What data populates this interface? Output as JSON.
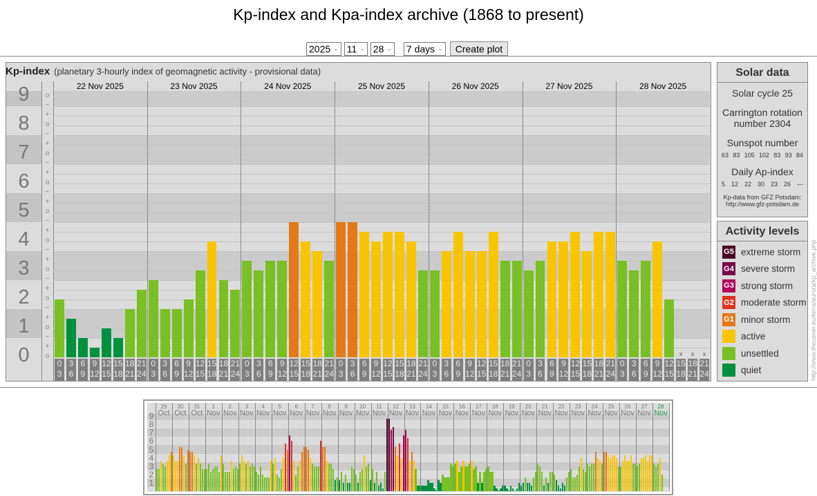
{
  "title": "Kp-index and Kpa-index archive (1868 to present)",
  "form": {
    "year": "2025",
    "month": "11",
    "day": "28",
    "range": "7 days",
    "button": "Create plot"
  },
  "kp_panel": {
    "name": "Kp-index",
    "subtitle": "(planetary 3-hourly index of geomagnetic activity - provisional data)"
  },
  "solar": {
    "title": "Solar data",
    "cycle": "Solar cycle 25",
    "carrington_1": "Carrington rotation",
    "carrington_2": "number 2304",
    "sunspot_label": "Sunspot number",
    "sunspots": [
      "63",
      "83",
      "105",
      "102",
      "83",
      "93",
      "84"
    ],
    "ap_label": "Daily Ap-index",
    "ap": [
      "5",
      "12",
      "22",
      "30",
      "23",
      "26",
      "---"
    ],
    "credit_1": "Kp-data from GFZ Potsdam:",
    "credit_2": "http://www.gfz-potsdam.de"
  },
  "activity": {
    "title": "Activity levels",
    "levels": [
      {
        "badge": "G5",
        "label": "extreme storm",
        "color": "#4a0726"
      },
      {
        "badge": "G4",
        "label": "severe storm",
        "color": "#7a0848"
      },
      {
        "badge": "G3",
        "label": "strong storm",
        "color": "#b0005a"
      },
      {
        "badge": "G2",
        "label": "moderate storm",
        "color": "#dc3420"
      },
      {
        "badge": "G1",
        "label": "minor storm",
        "color": "#e57917"
      },
      {
        "badge": "",
        "label": "active",
        "color": "#f8c500"
      },
      {
        "badge": "",
        "label": "unsettled",
        "color": "#78c023"
      },
      {
        "badge": "",
        "label": "quiet",
        "color": "#00913f"
      }
    ]
  },
  "side_url": "http://www.theusner.eu/terra/aurora/kp_archive.php",
  "chart_data": [
    {
      "type": "bar",
      "title": "Kp-index",
      "ylim": [
        0,
        9
      ],
      "y_labels": [
        "0",
        "1",
        "2",
        "3",
        "4",
        "5",
        "6",
        "7",
        "8",
        "9"
      ],
      "tick_marks": {
        "minus": "−",
        "zero": "o",
        "plus": "+"
      },
      "days": [
        "22 Nov 2025",
        "23 Nov 2025",
        "24 Nov 2025",
        "25 Nov 2025",
        "26 Nov 2025",
        "27 Nov 2025",
        "28 Nov 2025"
      ],
      "intervals": [
        [
          "0",
          "3"
        ],
        [
          "3",
          "6"
        ],
        [
          "6",
          "9"
        ],
        [
          "9",
          "12"
        ],
        [
          "12",
          "15"
        ],
        [
          "15",
          "18"
        ],
        [
          "18",
          "21"
        ],
        [
          "21",
          "24"
        ]
      ],
      "missing_mark": "x",
      "values": [
        [
          2,
          1.33,
          0.67,
          0.33,
          1,
          0.67,
          1.67,
          2.33
        ],
        [
          2.67,
          1.67,
          1.67,
          2,
          3,
          4,
          2.67,
          2.33
        ],
        [
          3.33,
          3,
          3.33,
          3.33,
          4.67,
          4,
          3.67,
          3.33
        ],
        [
          4.67,
          4.67,
          4.33,
          4,
          4.33,
          4.33,
          4,
          3
        ],
        [
          3,
          3.67,
          4.33,
          3.67,
          3.67,
          4.33,
          3.33,
          3.33
        ],
        [
          3,
          3.33,
          4,
          4,
          4.33,
          3.67,
          4.33,
          4.33
        ],
        [
          3.33,
          3,
          3.33,
          4,
          2,
          null,
          null,
          null
        ]
      ]
    },
    {
      "type": "bar",
      "title": "Kp-index overview",
      "ylim": [
        0,
        9
      ],
      "y_labels": [
        "1",
        "2",
        "3",
        "4",
        "5",
        "6",
        "7",
        "8",
        "9"
      ],
      "days": [
        [
          "29",
          "Oct"
        ],
        [
          "30",
          "Oct"
        ],
        [
          "31",
          "Oct"
        ],
        [
          "1",
          "Nov"
        ],
        [
          "2",
          "Nov"
        ],
        [
          "3",
          "Nov"
        ],
        [
          "4",
          "Nov"
        ],
        [
          "5",
          "Nov"
        ],
        [
          "6",
          "Nov"
        ],
        [
          "7",
          "Nov"
        ],
        [
          "8",
          "Nov"
        ],
        [
          "9",
          "Nov"
        ],
        [
          "10",
          "Nov"
        ],
        [
          "11",
          "Nov"
        ],
        [
          "12",
          "Nov"
        ],
        [
          "13",
          "Nov"
        ],
        [
          "14",
          "Nov"
        ],
        [
          "15",
          "Nov"
        ],
        [
          "16",
          "Nov"
        ],
        [
          "17",
          "Nov"
        ],
        [
          "18",
          "Nov"
        ],
        [
          "19",
          "Nov"
        ],
        [
          "20",
          "Nov"
        ],
        [
          "21",
          "Nov"
        ],
        [
          "22",
          "Nov"
        ],
        [
          "23",
          "Nov"
        ],
        [
          "24",
          "Nov"
        ],
        [
          "25",
          "Nov"
        ],
        [
          "26",
          "Nov"
        ],
        [
          "27",
          "Nov"
        ],
        [
          "28",
          "Nov"
        ]
      ],
      "current_day_color": "#1a9a4a",
      "values": [
        [
          2.67,
          2.67,
          3.67,
          3.33,
          3,
          3.67,
          4.33,
          4.67
        ],
        [
          4.33,
          3.67,
          3.67,
          5.33,
          5.33,
          4.33,
          3.33,
          5
        ],
        [
          4.67,
          4.67,
          4.33,
          3.33,
          4,
          3.33,
          2.67,
          2.67
        ],
        [
          2.67,
          3.33,
          2.33,
          2.67,
          3,
          3,
          2.33,
          4.33
        ],
        [
          3.33,
          2.33,
          2.33,
          2.33,
          3.67,
          2.67,
          3,
          2.67
        ],
        [
          3.33,
          4.33,
          3.67,
          3.33,
          3.67,
          3,
          3.33,
          3
        ],
        [
          2.33,
          2,
          3,
          2,
          1.67,
          1.67,
          1.67,
          3.67
        ],
        [
          3.33,
          4,
          2,
          1.67,
          2.67,
          4,
          5.67,
          5
        ],
        [
          6.67,
          6,
          3.67,
          2,
          3,
          3.67,
          4.67,
          5.33
        ],
        [
          5.33,
          5,
          4,
          3.33,
          3,
          3,
          3,
          6
        ],
        [
          5.33,
          5.33,
          3.67,
          3.33,
          3.33,
          2.67,
          1.33,
          1.67
        ],
        [
          1.33,
          2.33,
          1,
          2,
          1,
          1,
          3,
          2.67
        ],
        [
          2,
          1,
          2.33,
          2.67,
          4.33,
          3,
          3.33,
          1.33
        ],
        [
          2.67,
          1,
          2.33,
          0.67,
          1,
          0.33,
          2.33,
          8.67
        ],
        [
          8.67,
          7.33,
          7.67,
          5.33,
          4.33,
          5.67,
          4,
          6.67
        ],
        [
          7.33,
          6.33,
          3.67,
          4.67,
          3.67,
          2.67,
          0.67,
          0.67
        ],
        [
          0.67,
          0.67,
          0.67,
          1.33,
          1,
          1,
          0.33,
          0
        ],
        [
          1.33,
          1,
          2,
          1.67,
          1.67,
          1.67,
          3.33,
          3
        ],
        [
          3.33,
          3.67,
          2.33,
          3,
          3.67,
          3,
          3,
          3.33
        ],
        [
          3.67,
          2.67,
          3,
          1,
          2.33,
          1,
          2.33,
          2.67
        ],
        [
          3,
          2.33,
          2.33,
          0.67,
          0.33,
          0,
          0.33,
          0.67
        ],
        [
          0.67,
          0.33,
          0,
          0.67,
          0.33,
          0,
          0.33,
          1
        ],
        [
          0.67,
          1,
          1.67,
          1,
          1,
          0.67,
          1.67,
          2.33
        ],
        [
          3.33,
          3,
          2.33,
          0.67,
          1.67,
          1,
          2.33,
          2.33
        ],
        [
          2,
          1.33,
          0.67,
          0.33,
          1,
          0.67,
          1.67,
          2.33
        ],
        [
          2.67,
          1.67,
          1.67,
          2,
          3,
          4,
          2.67,
          2.33
        ],
        [
          3.33,
          3,
          3.33,
          3.33,
          4.67,
          4,
          3.67,
          3.33
        ],
        [
          4.67,
          4.67,
          4.33,
          4,
          4.33,
          4.33,
          4,
          3
        ],
        [
          3,
          3.67,
          4.33,
          3.67,
          3.67,
          4.33,
          3.33,
          3.33
        ],
        [
          3,
          3.33,
          4,
          4,
          4.33,
          3.67,
          4.33,
          4.33
        ],
        [
          3.33,
          3,
          3.33,
          4,
          2
        ]
      ]
    }
  ]
}
